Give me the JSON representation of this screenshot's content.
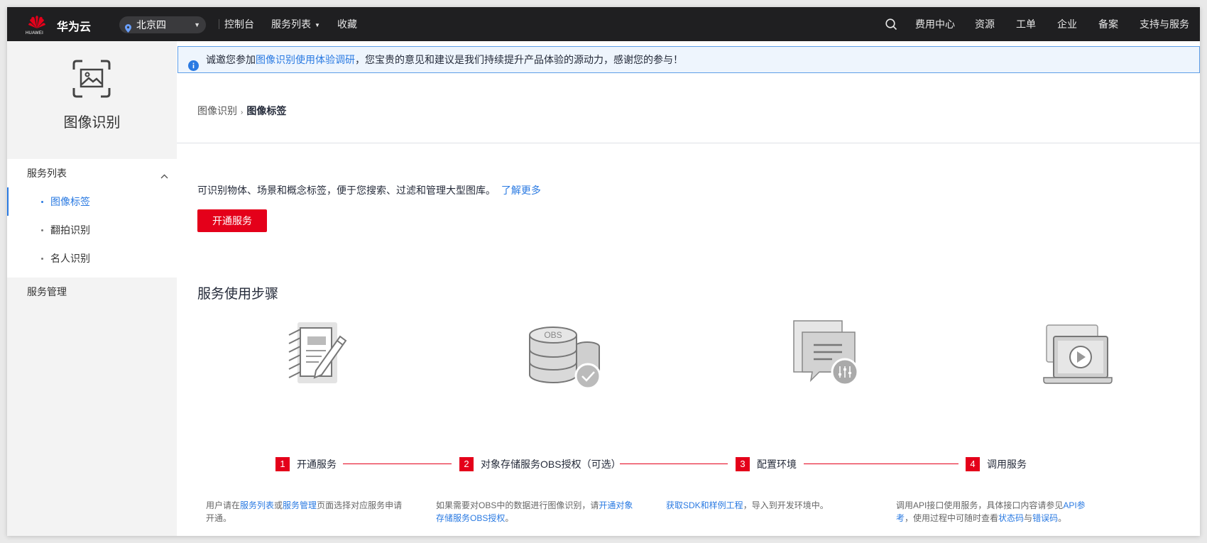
{
  "topbar": {
    "logo_text": "HUAWEI",
    "brand": "华为云",
    "region": "北京四",
    "nav_left": [
      "控制台",
      "服务列表",
      "收藏"
    ],
    "nav_right": [
      "费用中心",
      "资源",
      "工单",
      "企业",
      "备案",
      "支持与服务"
    ]
  },
  "sidebar": {
    "title": "图像识别",
    "group_label": "服务列表",
    "items": [
      "图像标签",
      "翻拍识别",
      "名人识别"
    ],
    "management": "服务管理"
  },
  "notice": {
    "prefix": "诚邀您参加",
    "link": "图像识别使用体验调研",
    "suffix": "，您宝贵的意见和建议是我们持续提升产品体验的源动力，感谢您的参与！"
  },
  "breadcrumb": {
    "parent": "图像识别",
    "sep": "›",
    "current": "图像标签"
  },
  "intro": {
    "text": "可识别物体、场景和概念标签，便于您搜索、过滤和管理大型图库。",
    "link": "了解更多",
    "button": "开通服务"
  },
  "steps_title": "服务使用步骤",
  "steps": [
    {
      "num": "1",
      "label": "开通服务",
      "desc": {
        "t1": "用户请在",
        "l1": "服务列表",
        "t2": "或",
        "l2": "服务管理",
        "t3": "页面选择对应服务申请开通。"
      }
    },
    {
      "num": "2",
      "label": "对象存储服务OBS授权（可选）",
      "obs_text": "OBS",
      "desc": {
        "t1": "如果需要对OBS中的数据进行图像识别，请",
        "l1": "开通对象存储服务OBS授权",
        "t2": "。"
      }
    },
    {
      "num": "3",
      "label": "配置环境",
      "desc": {
        "l1": "获取SDK和样例工程",
        "t1": "，导入到开发环境中。"
      }
    },
    {
      "num": "4",
      "label": "调用服务",
      "desc": {
        "t1": "调用API接口使用服务，具体接口内容请参见",
        "l1": "API参考",
        "t2": "，使用过程中可随时查看",
        "l2": "状态码",
        "t3": "与",
        "l3": "错误码",
        "t4": "。"
      }
    }
  ],
  "colors": {
    "accent_red": "#e4001a",
    "link_blue": "#2a7ae2",
    "topbar_bg": "#1f1f21"
  }
}
